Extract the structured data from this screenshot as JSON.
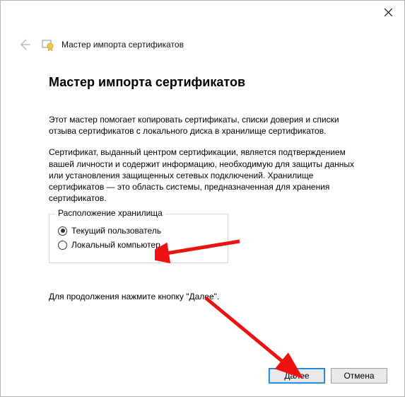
{
  "window": {
    "header_title": "Мастер импорта сертификатов"
  },
  "page": {
    "title": "Мастер импорта сертификатов",
    "para1": "Этот мастер помогает копировать сертификаты, списки доверия и списки отзыва сертификатов с локального диска в хранилище сертификатов.",
    "para2": "Сертификат, выданный центром сертификации, является подтверждением вашей личности и содержит информацию, необходимую для защиты данных или установления защищенных сетевых подключений. Хранилище сертификатов — это область системы, предназначенная для хранения сертификатов.",
    "group_legend": "Расположение хранилища",
    "radio_current_user": "Текущий пользователь",
    "radio_local_machine": "Локальный компьютер",
    "continue_note": "Для продолжения нажмите кнопку \"Далее\"."
  },
  "buttons": {
    "next": "Далее",
    "cancel": "Отмена"
  }
}
